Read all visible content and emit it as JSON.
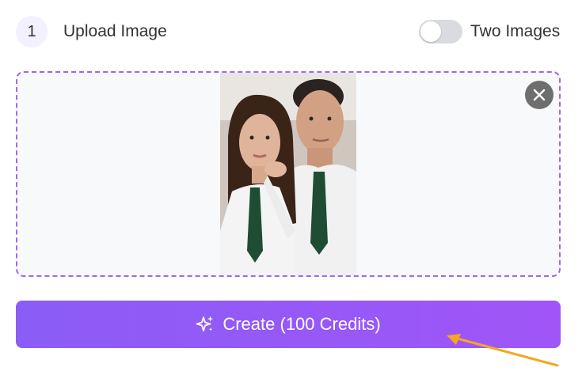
{
  "header": {
    "step_number": "1",
    "title": "Upload Image",
    "toggle_label": "Two Images",
    "toggle_on": false
  },
  "dropzone": {
    "preview_icon": "uploaded-photo",
    "remove_icon": "close-icon"
  },
  "create": {
    "label": "Create (100 Credits)",
    "icon": "sparkle-icon"
  },
  "colors": {
    "accent": "#8b5cf6",
    "accent_end": "#a055f7",
    "dropzone_border": "#a066f0",
    "arrow": "#f5a623"
  }
}
